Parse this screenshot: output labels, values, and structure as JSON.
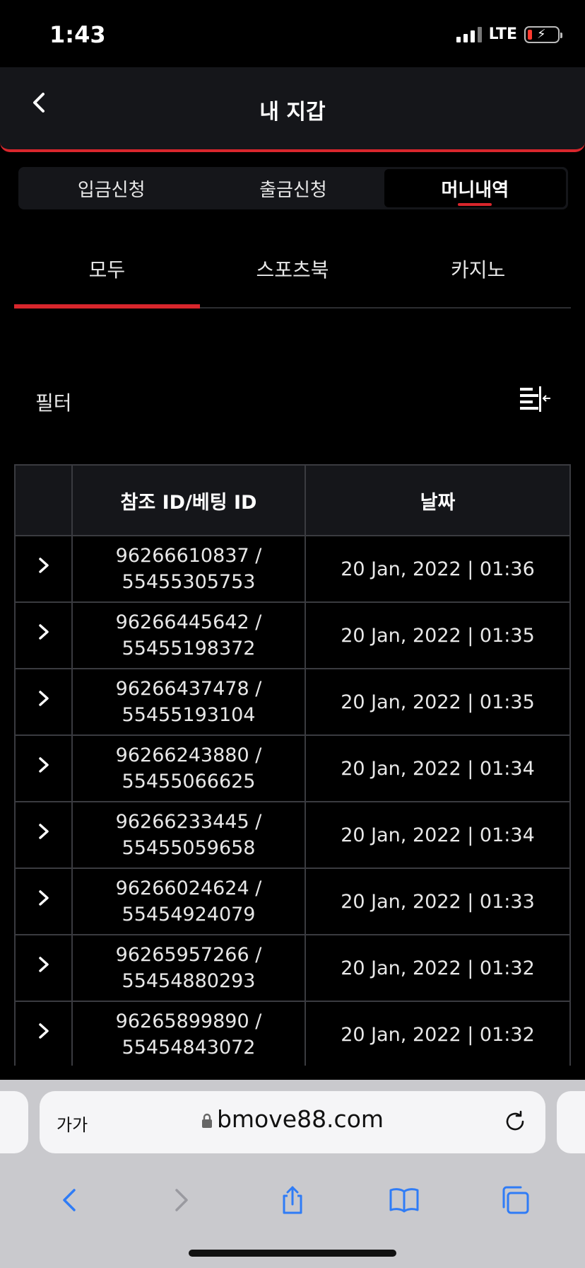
{
  "status": {
    "time": "1:43",
    "network": "LTE"
  },
  "header": {
    "title": "내 지갑"
  },
  "segment": [
    {
      "label": "입금신청",
      "active": false
    },
    {
      "label": "출금신청",
      "active": false
    },
    {
      "label": "머니내역",
      "active": true
    }
  ],
  "categories": [
    {
      "label": "모두",
      "active": true
    },
    {
      "label": "스포츠북",
      "active": false
    },
    {
      "label": "카지노",
      "active": false
    }
  ],
  "filter": {
    "label": "필터"
  },
  "table": {
    "headers": {
      "blank": "",
      "ref": "참조 ID/베팅 ID",
      "date": "날짜"
    },
    "rows": [
      {
        "ref_id": "96266610837 /",
        "bet_id": "55455305753",
        "date": "20 Jan, 2022 | 01:36"
      },
      {
        "ref_id": "96266445642 /",
        "bet_id": "55455198372",
        "date": "20 Jan, 2022 | 01:35"
      },
      {
        "ref_id": "96266437478 /",
        "bet_id": "55455193104",
        "date": "20 Jan, 2022 | 01:35"
      },
      {
        "ref_id": "96266243880 /",
        "bet_id": "55455066625",
        "date": "20 Jan, 2022 | 01:34"
      },
      {
        "ref_id": "96266233445 /",
        "bet_id": "55455059658",
        "date": "20 Jan, 2022 | 01:34"
      },
      {
        "ref_id": "96266024624 /",
        "bet_id": "55454924079",
        "date": "20 Jan, 2022 | 01:33"
      },
      {
        "ref_id": "96265957266 /",
        "bet_id": "55454880293",
        "date": "20 Jan, 2022 | 01:32"
      },
      {
        "ref_id": "96265899890 /",
        "bet_id": "55454843072",
        "date": "20 Jan, 2022 | 01:32"
      }
    ]
  },
  "browser": {
    "text_size_label": "가가",
    "url": "bmove88.com"
  },
  "colors": {
    "accent": "#d8262c",
    "panel": "#15161a",
    "background": "#000000",
    "ios_blue": "#2f7cf6"
  },
  "icons": {
    "back": "chevron-left-icon",
    "row": "chevron-right-icon",
    "filter": "filter-collapse-icon",
    "lock": "lock-icon",
    "reload": "reload-icon",
    "share": "share-icon",
    "bookmarks": "book-icon",
    "tabs": "tabs-icon"
  }
}
